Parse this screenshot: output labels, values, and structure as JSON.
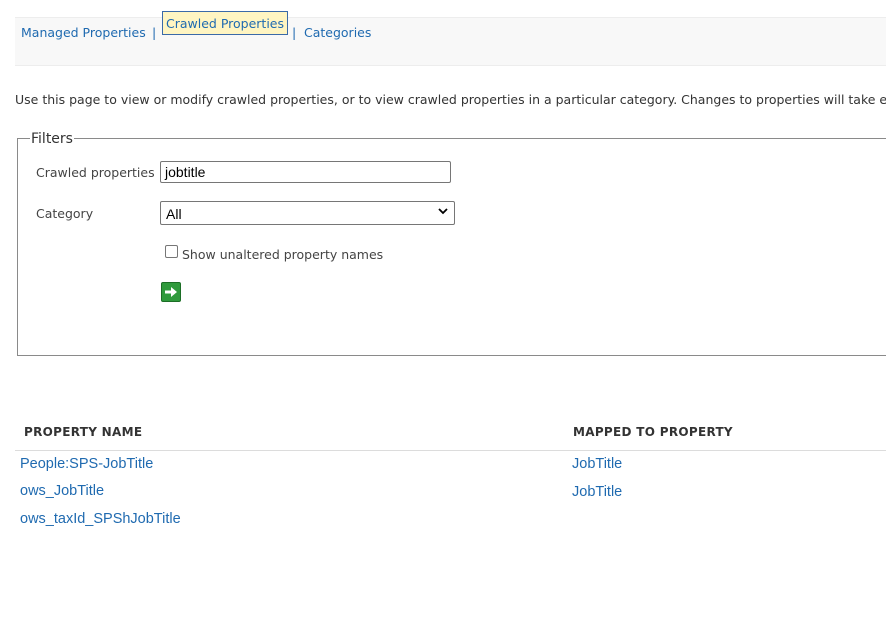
{
  "nav": {
    "tabs": [
      {
        "label": "Managed Properties",
        "active": false
      },
      {
        "label": "Crawled Properties",
        "active": true
      },
      {
        "label": "Categories",
        "active": false
      }
    ],
    "separator": "|"
  },
  "description": "Use this page to view or modify crawled properties, or to view crawled properties in a particular category. Changes to properties will take ef",
  "filters": {
    "legend": "Filters",
    "crawled_label": "Crawled properties",
    "crawled_value": "jobtitle",
    "category_label": "Category",
    "category_selected": "All",
    "checkbox_label": "Show unaltered property names",
    "checkbox_checked": false,
    "go_icon": "go-arrow-icon"
  },
  "table": {
    "headers": [
      "PROPERTY NAME",
      "MAPPED TO PROPERTY"
    ],
    "rows": [
      {
        "name": "People:SPS-JobTitle",
        "mapped": "JobTitle"
      },
      {
        "name": "ows_JobTitle",
        "mapped": "JobTitle"
      },
      {
        "name": "ows_taxId_SPShJobTitle",
        "mapped": ""
      }
    ]
  },
  "colors": {
    "link": "#1f6ab0",
    "active_tab_bg": "#fff5c2",
    "go_button": "#2f9a3c"
  }
}
